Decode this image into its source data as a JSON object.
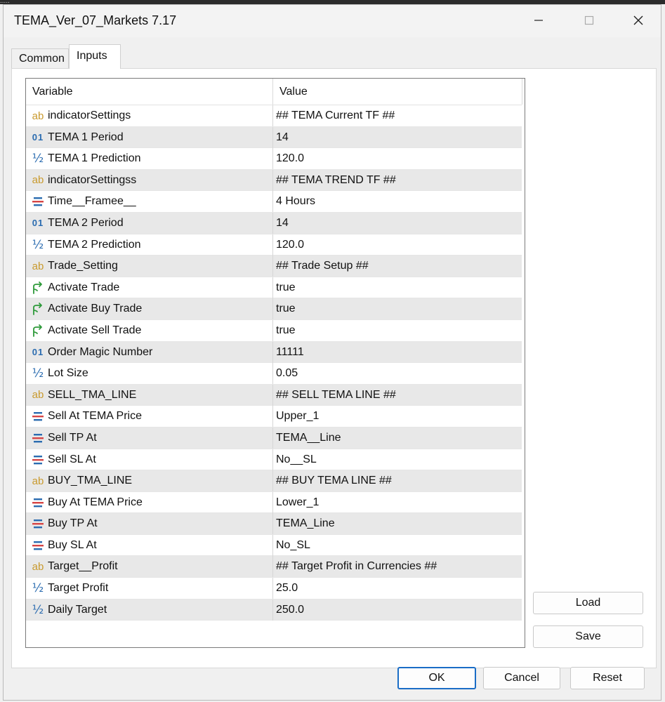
{
  "window": {
    "title": "TEMA_Ver_07_Markets 7.17",
    "background_strip_text": "....."
  },
  "tabs": [
    {
      "label": "Common",
      "active": false
    },
    {
      "label": "Inputs",
      "active": true
    }
  ],
  "grid": {
    "columns": {
      "variable": "Variable",
      "value": "Value"
    },
    "rows": [
      {
        "icon": "ab",
        "name": "indicatorSettings",
        "value": "## TEMA Current TF ##"
      },
      {
        "icon": "int",
        "name": "TEMA 1 Period",
        "value": "14"
      },
      {
        "icon": "half",
        "name": "TEMA 1 Prediction",
        "value": "120.0"
      },
      {
        "icon": "ab",
        "name": "indicatorSettingss",
        "value": "## TEMA TREND TF ##"
      },
      {
        "icon": "enum",
        "name": "Time__Framee__",
        "value": "4 Hours"
      },
      {
        "icon": "int",
        "name": "TEMA 2 Period",
        "value": "14"
      },
      {
        "icon": "half",
        "name": "TEMA 2 Prediction",
        "value": "120.0"
      },
      {
        "icon": "ab",
        "name": "Trade_Setting",
        "value": "## Trade Setup ##"
      },
      {
        "icon": "bool",
        "name": "Activate Trade",
        "value": "true"
      },
      {
        "icon": "bool",
        "name": "Activate Buy Trade",
        "value": "true"
      },
      {
        "icon": "bool",
        "name": "Activate Sell Trade",
        "value": "true"
      },
      {
        "icon": "int",
        "name": "Order Magic Number",
        "value": "11111"
      },
      {
        "icon": "half",
        "name": "Lot Size",
        "value": "0.05"
      },
      {
        "icon": "ab",
        "name": "SELL_TMA_LINE",
        "value": "## SELL TEMA LINE ##"
      },
      {
        "icon": "enum",
        "name": "Sell At TEMA Price",
        "value": "Upper_1"
      },
      {
        "icon": "enum",
        "name": "Sell TP At",
        "value": "TEMA__Line"
      },
      {
        "icon": "enum",
        "name": "Sell SL At",
        "value": "No__SL"
      },
      {
        "icon": "ab",
        "name": "BUY_TMA_LINE",
        "value": "## BUY TEMA LINE ##"
      },
      {
        "icon": "enum",
        "name": "Buy At TEMA Price",
        "value": "Lower_1"
      },
      {
        "icon": "enum",
        "name": "Buy TP At",
        "value": "TEMA_Line"
      },
      {
        "icon": "enum",
        "name": "Buy SL At",
        "value": "No_SL"
      },
      {
        "icon": "ab",
        "name": "Target__Profit",
        "value": "## Target Profit in Currencies ##"
      },
      {
        "icon": "half",
        "name": "Target Profit",
        "value": "25.0"
      },
      {
        "icon": "half",
        "name": "Daily Target",
        "value": "250.0"
      }
    ]
  },
  "buttons": {
    "load": "Load",
    "save": "Save",
    "ok": "OK",
    "cancel": "Cancel",
    "reset": "Reset"
  },
  "icon_names": {
    "ab": "string-type-icon",
    "int": "integer-type-icon",
    "half": "double-type-icon",
    "enum": "enum-type-icon",
    "bool": "bool-type-icon"
  },
  "colors": {
    "string_icon": "#c99a2e",
    "numeric_icon": "#2b6cb0",
    "bool_icon": "#2e9a3a",
    "ok_border": "#1a6dc6",
    "alt_row": "#e8e8e8"
  }
}
